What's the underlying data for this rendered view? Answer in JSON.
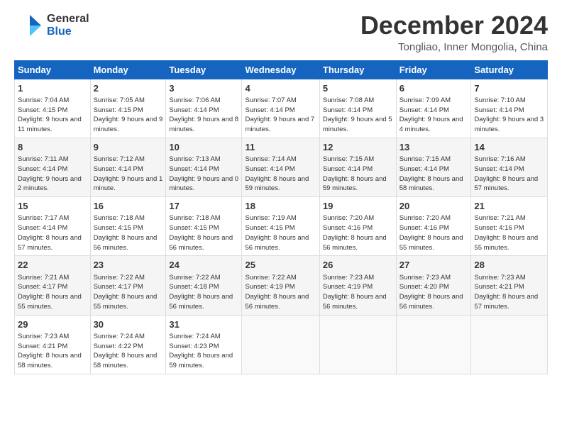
{
  "header": {
    "logo_general": "General",
    "logo_blue": "Blue",
    "month": "December 2024",
    "location": "Tongliao, Inner Mongolia, China"
  },
  "days_of_week": [
    "Sunday",
    "Monday",
    "Tuesday",
    "Wednesday",
    "Thursday",
    "Friday",
    "Saturday"
  ],
  "weeks": [
    [
      {
        "day": "1",
        "info": "Sunrise: 7:04 AM\nSunset: 4:15 PM\nDaylight: 9 hours\nand 11 minutes."
      },
      {
        "day": "2",
        "info": "Sunrise: 7:05 AM\nSunset: 4:15 PM\nDaylight: 9 hours\nand 9 minutes."
      },
      {
        "day": "3",
        "info": "Sunrise: 7:06 AM\nSunset: 4:14 PM\nDaylight: 9 hours\nand 8 minutes."
      },
      {
        "day": "4",
        "info": "Sunrise: 7:07 AM\nSunset: 4:14 PM\nDaylight: 9 hours\nand 7 minutes."
      },
      {
        "day": "5",
        "info": "Sunrise: 7:08 AM\nSunset: 4:14 PM\nDaylight: 9 hours\nand 5 minutes."
      },
      {
        "day": "6",
        "info": "Sunrise: 7:09 AM\nSunset: 4:14 PM\nDaylight: 9 hours\nand 4 minutes."
      },
      {
        "day": "7",
        "info": "Sunrise: 7:10 AM\nSunset: 4:14 PM\nDaylight: 9 hours\nand 3 minutes."
      }
    ],
    [
      {
        "day": "8",
        "info": "Sunrise: 7:11 AM\nSunset: 4:14 PM\nDaylight: 9 hours\nand 2 minutes."
      },
      {
        "day": "9",
        "info": "Sunrise: 7:12 AM\nSunset: 4:14 PM\nDaylight: 9 hours\nand 1 minute."
      },
      {
        "day": "10",
        "info": "Sunrise: 7:13 AM\nSunset: 4:14 PM\nDaylight: 9 hours\nand 0 minutes."
      },
      {
        "day": "11",
        "info": "Sunrise: 7:14 AM\nSunset: 4:14 PM\nDaylight: 8 hours\nand 59 minutes."
      },
      {
        "day": "12",
        "info": "Sunrise: 7:15 AM\nSunset: 4:14 PM\nDaylight: 8 hours\nand 59 minutes."
      },
      {
        "day": "13",
        "info": "Sunrise: 7:15 AM\nSunset: 4:14 PM\nDaylight: 8 hours\nand 58 minutes."
      },
      {
        "day": "14",
        "info": "Sunrise: 7:16 AM\nSunset: 4:14 PM\nDaylight: 8 hours\nand 57 minutes."
      }
    ],
    [
      {
        "day": "15",
        "info": "Sunrise: 7:17 AM\nSunset: 4:14 PM\nDaylight: 8 hours\nand 57 minutes."
      },
      {
        "day": "16",
        "info": "Sunrise: 7:18 AM\nSunset: 4:15 PM\nDaylight: 8 hours\nand 56 minutes."
      },
      {
        "day": "17",
        "info": "Sunrise: 7:18 AM\nSunset: 4:15 PM\nDaylight: 8 hours\nand 56 minutes."
      },
      {
        "day": "18",
        "info": "Sunrise: 7:19 AM\nSunset: 4:15 PM\nDaylight: 8 hours\nand 56 minutes."
      },
      {
        "day": "19",
        "info": "Sunrise: 7:20 AM\nSunset: 4:16 PM\nDaylight: 8 hours\nand 56 minutes."
      },
      {
        "day": "20",
        "info": "Sunrise: 7:20 AM\nSunset: 4:16 PM\nDaylight: 8 hours\nand 55 minutes."
      },
      {
        "day": "21",
        "info": "Sunrise: 7:21 AM\nSunset: 4:16 PM\nDaylight: 8 hours\nand 55 minutes."
      }
    ],
    [
      {
        "day": "22",
        "info": "Sunrise: 7:21 AM\nSunset: 4:17 PM\nDaylight: 8 hours\nand 55 minutes."
      },
      {
        "day": "23",
        "info": "Sunrise: 7:22 AM\nSunset: 4:17 PM\nDaylight: 8 hours\nand 55 minutes."
      },
      {
        "day": "24",
        "info": "Sunrise: 7:22 AM\nSunset: 4:18 PM\nDaylight: 8 hours\nand 56 minutes."
      },
      {
        "day": "25",
        "info": "Sunrise: 7:22 AM\nSunset: 4:19 PM\nDaylight: 8 hours\nand 56 minutes."
      },
      {
        "day": "26",
        "info": "Sunrise: 7:23 AM\nSunset: 4:19 PM\nDaylight: 8 hours\nand 56 minutes."
      },
      {
        "day": "27",
        "info": "Sunrise: 7:23 AM\nSunset: 4:20 PM\nDaylight: 8 hours\nand 56 minutes."
      },
      {
        "day": "28",
        "info": "Sunrise: 7:23 AM\nSunset: 4:21 PM\nDaylight: 8 hours\nand 57 minutes."
      }
    ],
    [
      {
        "day": "29",
        "info": "Sunrise: 7:23 AM\nSunset: 4:21 PM\nDaylight: 8 hours\nand 58 minutes."
      },
      {
        "day": "30",
        "info": "Sunrise: 7:24 AM\nSunset: 4:22 PM\nDaylight: 8 hours\nand 58 minutes."
      },
      {
        "day": "31",
        "info": "Sunrise: 7:24 AM\nSunset: 4:23 PM\nDaylight: 8 hours\nand 59 minutes."
      },
      null,
      null,
      null,
      null
    ]
  ]
}
